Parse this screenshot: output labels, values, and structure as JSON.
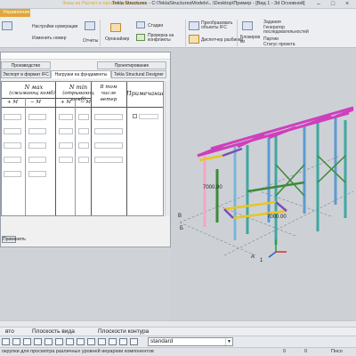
{
  "window": {
    "title": "Tekla Structures - C:\\TeklaStructuresModels\\...\\Desktop\\Пример - [Вид 1 - 3d Основной]",
    "faded_tabs": [
      "Зоны вз",
      "Расчет и проектирование вз"
    ],
    "colors": {
      "accent": "#e0a63a",
      "viewport": "#cdd1d6"
    }
  },
  "ribbon": {
    "active_tab": "Управление",
    "items": {
      "numbering": "Настройки нумерации",
      "change_number": "Изменить номер",
      "reports": "Отчеты",
      "organizer": "Органайзер",
      "stages": "Стадии",
      "check_conflicts": "Проверка на конфликты",
      "convert_ifc": "Преобразовать объекты IFC",
      "dispatcher": "Диспетчер разбивки",
      "lock": "Блокиров ки",
      "tasks": "Задания",
      "generator": "Генератор последовательностей",
      "batches": "Партии",
      "status": "Статус проекта"
    }
  },
  "dialog": {
    "tabs_row1": [
      "Производство",
      "Проектирование"
    ],
    "tabs_row2": [
      "Экспорт в формат IFC",
      "Нагрузки на фундаменты",
      "Tekla Structural Designer"
    ],
    "active_tab": "Нагрузки на фундаменты",
    "headers": {
      "n_max": "N мах",
      "n_max_sub": "(сжимающ комб)",
      "n_min": "N min",
      "n_min_sub": "(отрывающ комб)",
      "wind": "В том числе ветер",
      "note": "Примечание",
      "plus_m": "+ M",
      "minus_m": "− M"
    },
    "button": "Применить"
  },
  "model": {
    "dim_labels": [
      "7000.00",
      "7000.00"
    ],
    "grid_labels": [
      "В",
      "Б",
      "А",
      "1"
    ]
  },
  "bottom": {
    "view_label": "вто",
    "view_plane": "Плоскость вида",
    "contour_planes": "Плоскости контура",
    "std_value": "standard",
    "status_text": "окрупки для просмотра различных уровней иерархии компонентов",
    "status_right": [
      "Пнсо",
      "0",
      "0"
    ]
  }
}
